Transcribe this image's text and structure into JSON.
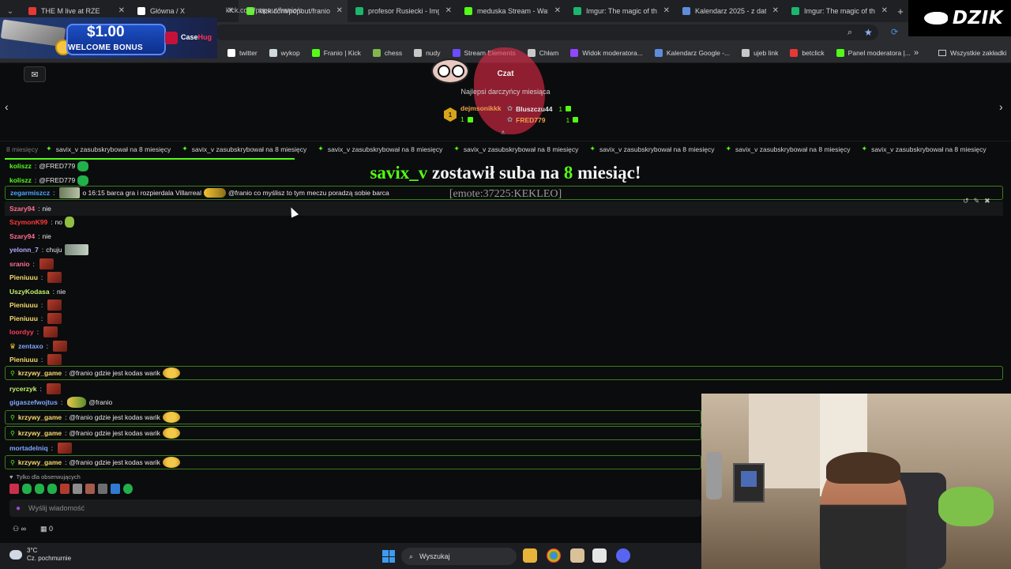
{
  "browser": {
    "tabs": [
      {
        "title": "THE M live at RZE",
        "favicon_color": "#e53935",
        "active": false
      },
      {
        "title": "Główna / X",
        "favicon_color": "#ffffff",
        "active": false
      },
      {
        "title": "kick.com/popout/franio/c",
        "favicon_color": "#53fc18",
        "active": true
      },
      {
        "title": "profesor Rusiecki - Imgur",
        "favicon_color": "#1bb76e",
        "active": false
      },
      {
        "title": "meduska Stream - Watch",
        "favicon_color": "#53fc18",
        "active": false
      },
      {
        "title": "Imgur: The magic of the I",
        "favicon_color": "#1bb76e",
        "active": false
      },
      {
        "title": "Kalendarz 2025 - z datam",
        "favicon_color": "#5f8ddb",
        "active": false
      },
      {
        "title": "Imgur: The magic of the I",
        "favicon_color": "#1bb76e",
        "active": false
      }
    ],
    "new_tab": "+",
    "bookmarks": [
      {
        "label": "twitter",
        "icon": "x-icon",
        "color": "#ffffff"
      },
      {
        "label": "wykop",
        "icon": "wykop-icon",
        "color": "#cfd8dc"
      },
      {
        "label": "Franio | Kick",
        "icon": "kick-icon",
        "color": "#53fc18"
      },
      {
        "label": "chess",
        "icon": "chess-icon",
        "color": "#81b64c"
      },
      {
        "label": "nudy",
        "icon": "folder-icon",
        "color": "#c8c8c8"
      },
      {
        "label": "Stream Elements",
        "icon": "streamelements-icon",
        "color": "#6c4cff"
      },
      {
        "label": "Chłam",
        "icon": "globe-icon",
        "color": "#c8c8c8"
      },
      {
        "label": "Widok moderatora...",
        "icon": "twitch-icon",
        "color": "#9146ff"
      },
      {
        "label": "Kalendarz Google -...",
        "icon": "calendar-icon",
        "color": "#5f8ddb"
      },
      {
        "label": "ujeb link",
        "icon": "globe-icon",
        "color": "#c8c8c8"
      },
      {
        "label": "betclick",
        "icon": "betclick-icon",
        "color": "#e53935"
      },
      {
        "label": "Panel moderatora |...",
        "icon": "kick-icon",
        "color": "#53fc18"
      }
    ],
    "bookmarks_all": "Wszystkie zakładki",
    "bookmarks_more": "»"
  },
  "ad": {
    "amount": "$1.00",
    "welcome": "WELCOME BONUS",
    "brand_case": "Case",
    "brand_hug": "Hug"
  },
  "logo": {
    "text": "DZIK"
  },
  "chat": {
    "title": "Czat",
    "leaders_title": "Najlepsi darczyńcy miesiąca",
    "rank": "1",
    "leaders": [
      {
        "name": "dejmsonikkk",
        "count": "1",
        "color": "#f0a04b"
      },
      {
        "name": "Bluszczu44",
        "count": "1",
        "color": "#e8e8e8"
      },
      {
        "name": "FRED779",
        "count": "1",
        "color": "#f0a04b"
      }
    ],
    "ticker_text": "savix_v zasubskrybował na 8 miesięcy",
    "ticker_lead": "8 miesięcy",
    "alert": {
      "user": "savix_v",
      "middle": "zostawił suba na",
      "months": "8",
      "end": "miesiąc!",
      "sub": "[emote:37225:KEKLEO]"
    },
    "messages": [
      {
        "user": "koliszz",
        "user_color": "#53fc18",
        "text": "@FRED779",
        "emote_after": "kick"
      },
      {
        "user": "koliszz",
        "user_color": "#53fc18",
        "text": "@FRED779",
        "emote_after": "kick"
      },
      {
        "user": "zegarmiszcz",
        "user_color": "#4aa8ff",
        "text_before": "o 16:15 barca gra i rozpierdala Villarreal",
        "text": "@franio co myślisz to tym meczu poradzą sobie barca",
        "pinned": true
      },
      {
        "user": "Szary94",
        "user_color": "#ff6f91",
        "text": "nie",
        "hover": true
      },
      {
        "user": "SzymonK99",
        "user_color": "#ff3b3b",
        "text": "no"
      },
      {
        "user": "Szary94",
        "user_color": "#ff6f91",
        "text": "nie"
      },
      {
        "user": "yelonn_7",
        "user_color": "#b9a7ff",
        "text": "chuju"
      },
      {
        "user": "sranio",
        "user_color": "#ff6f91",
        "text": ""
      },
      {
        "user": "Pieniuuu",
        "user_color": "#f6d96b",
        "text": ""
      },
      {
        "user": "UszyKodasa",
        "user_color": "#c3f36b",
        "text": "nie"
      },
      {
        "user": "Pieniuuu",
        "user_color": "#f6d96b",
        "text": ""
      },
      {
        "user": "Pieniuuu",
        "user_color": "#f6d96b",
        "text": ""
      },
      {
        "user": "loordyy",
        "user_color": "#ff3b5c",
        "text": ""
      },
      {
        "user": "zentaxo",
        "user_color": "#7fa7ff",
        "text": ""
      },
      {
        "user": "Pieniuuu",
        "user_color": "#f6d96b",
        "text": ""
      },
      {
        "user": "krzywy_game",
        "user_color": "#f6d96b",
        "text": "@franio gdzie jest kodas warik",
        "pinned": true
      },
      {
        "user": "rycerzyk",
        "user_color": "#c3f36b",
        "text": ""
      },
      {
        "user": "gigaszefwojtus",
        "user_color": "#7fa7ff",
        "text": "@franio"
      },
      {
        "user": "krzywy_game",
        "user_color": "#f6d96b",
        "text": "@franio gdzie jest kodas warik",
        "pinned": true
      },
      {
        "user": "krzywy_game",
        "user_color": "#f6d96b",
        "text": "@franio gdzie jest kodas warik",
        "pinned": true
      },
      {
        "user": "mortadelniq",
        "user_color": "#7fa7ff",
        "text": ""
      },
      {
        "user": "krzywy_game",
        "user_color": "#f6d96b",
        "text": "@franio gdzie jest kodas warik",
        "pinned": true
      }
    ],
    "followers_only": "Tylko dla obserwujących",
    "input_placeholder": "Wyślij wiadomość",
    "footer_infinity": "∞",
    "footer_count": "0"
  },
  "taskbar": {
    "temperature": "3°C",
    "weather": "Cz. pochmurnie",
    "search_placeholder": "Wyszukaj"
  }
}
